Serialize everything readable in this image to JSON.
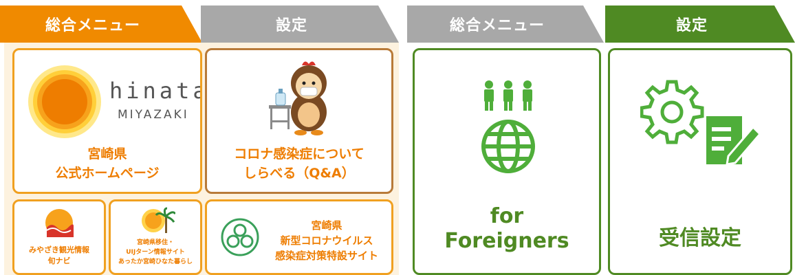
{
  "left_panel": {
    "tabs": {
      "menu": "総合メニュー",
      "settings": "設定"
    },
    "cards": {
      "hinata": {
        "logo_word": "hinata",
        "logo_sub": "MIYAZAKI",
        "line1": "宮崎県",
        "line2": "公式ホームページ"
      },
      "corona": {
        "line1": "コロナ感染症について",
        "line2": "しらべる（Q&A）"
      },
      "tourism": {
        "line1": "みやざき観光情報",
        "line2": "旬ナビ"
      },
      "relocation": {
        "line1": "宮崎県移住・",
        "line2": "UIJターン情報サイト",
        "line3": "あったか宮崎ひなた暮らし"
      },
      "covid_site": {
        "line1": "宮崎県",
        "line2": "新型コロナウイルス",
        "line3": "感染症対策特設サイト"
      }
    }
  },
  "right_panel": {
    "tabs": {
      "menu": "総合メニュー",
      "settings": "設定"
    },
    "cards": {
      "foreigners": {
        "line1": "for",
        "line2": "Foreigners"
      },
      "receive": {
        "label": "受信設定"
      }
    }
  },
  "colors": {
    "orange": "#f08a00",
    "gray": "#a8a8a8",
    "green": "#4f8a23",
    "cream": "#fdf2df",
    "brown": "#b87a38"
  }
}
